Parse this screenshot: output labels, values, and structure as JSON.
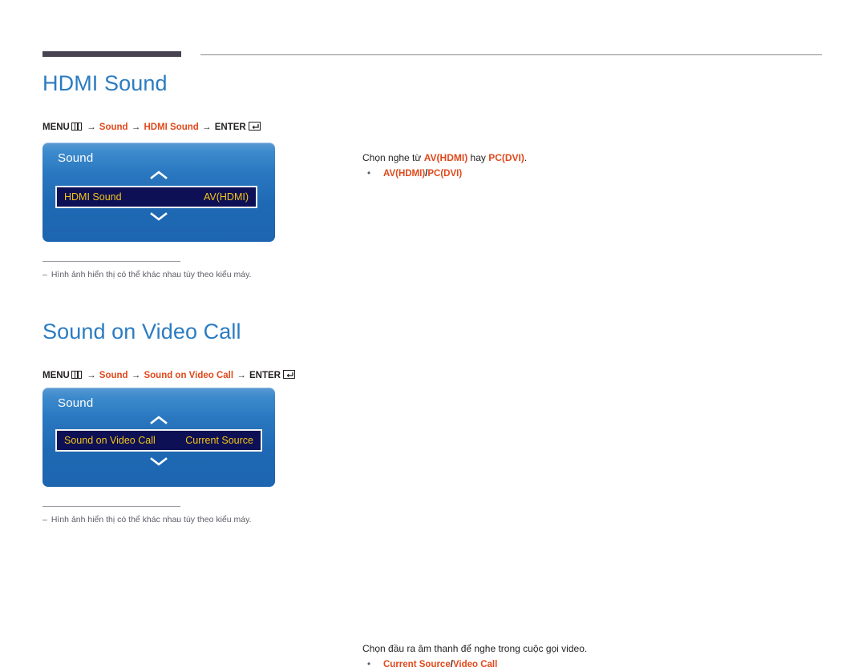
{
  "page": {
    "background": "#ffffff",
    "accent_blue": "#2b7cc2",
    "accent_orange": "#e0491c",
    "rule_dark": "#474350",
    "osd_highlight_bg": "#0d1055",
    "osd_highlight_text": "#f5c518"
  },
  "header": {
    "thick_rule": "",
    "thin_rule": ""
  },
  "sections": [
    {
      "title": "HDMI Sound",
      "menu_path": {
        "menu_label": "MENU",
        "menu_icon": "menu-grid-icon",
        "arrow": "→",
        "step1": "Sound",
        "step2": "HDMI Sound",
        "enter_label": "ENTER",
        "enter_icon": "enter-return-icon"
      },
      "osd": {
        "title": "Sound",
        "scroll_up_icon": "chevron-up-icon",
        "scroll_down_icon": "chevron-down-icon",
        "row_label": "HDMI Sound",
        "row_value": "AV(HDMI)"
      },
      "footnote": {
        "dash": "–",
        "text": "Hình ảnh hiển thị có thể khác nhau tùy theo kiểu máy."
      },
      "description": {
        "lead_pre": "Chọn nghe từ ",
        "lead_em1": "AV(HDMI)",
        "lead_mid": " hay ",
        "lead_em2": "PC(DVI)",
        "lead_post": ".",
        "bullet_dot": "•",
        "bullet_opt1": "AV(HDMI)",
        "bullet_sep": " / ",
        "bullet_opt2": "PC(DVI)"
      }
    },
    {
      "title": "Sound on Video Call",
      "menu_path": {
        "menu_label": "MENU",
        "menu_icon": "menu-grid-icon",
        "arrow": "→",
        "step1": "Sound",
        "step2": "Sound on Video Call",
        "enter_label": "ENTER",
        "enter_icon": "enter-return-icon"
      },
      "osd": {
        "title": "Sound",
        "scroll_up_icon": "chevron-up-icon",
        "scroll_down_icon": "chevron-down-icon",
        "row_label": "Sound on Video Call",
        "row_value": "Current Source"
      },
      "footnote": {
        "dash": "–",
        "text": "Hình ảnh hiển thị có thể khác nhau tùy theo kiểu máy."
      },
      "description": {
        "lead_pre": "Chọn đầu ra âm thanh để nghe trong cuộc gọi video.",
        "lead_em1": "",
        "lead_mid": "",
        "lead_em2": "",
        "lead_post": "",
        "bullet_dot": "•",
        "bullet_opt1": "Current Source",
        "bullet_sep": " / ",
        "bullet_opt2": "Video Call"
      }
    }
  ]
}
